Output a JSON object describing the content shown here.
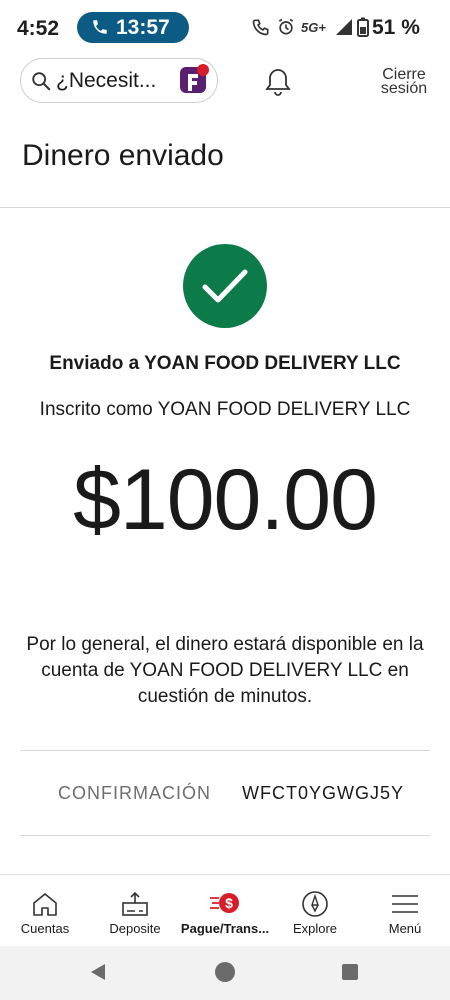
{
  "status_bar": {
    "time": "4:52",
    "call_timer": "13:57",
    "network": "5G+",
    "battery": "51 %"
  },
  "header": {
    "search_placeholder": "¿Necesit...",
    "sign_out_line1": "Cierre",
    "sign_out_line2": "sesión"
  },
  "page": {
    "title": "Dinero enviado"
  },
  "confirmation": {
    "sent_to": "Enviado a YOAN FOOD DELIVERY LLC",
    "registered_as": "Inscrito como YOAN FOOD DELIVERY LLC",
    "amount": "$100.00",
    "note": "Por lo general, el dinero estará disponible en la cuenta de YOAN FOOD DELIVERY LLC en cuestión de minutos.",
    "code_label": "CONFIRMACIÓN",
    "code_value": "WFCT0YGWGJ5Y"
  },
  "bottom_nav": {
    "items": [
      {
        "label": "Cuentas",
        "icon": "house-icon"
      },
      {
        "label": "Deposite",
        "icon": "deposit-check-icon"
      },
      {
        "label": "Pague/Trans...",
        "icon": "pay-transfer-icon"
      },
      {
        "label": "Explore",
        "icon": "compass-icon"
      },
      {
        "label": "Menú",
        "icon": "hamburger-menu-icon"
      }
    ]
  },
  "colors": {
    "success_green": "#0d7a4a",
    "brand_red": "#d71e28",
    "brand_purple": "#5a1f6e",
    "call_pill": "#0b5b84"
  }
}
